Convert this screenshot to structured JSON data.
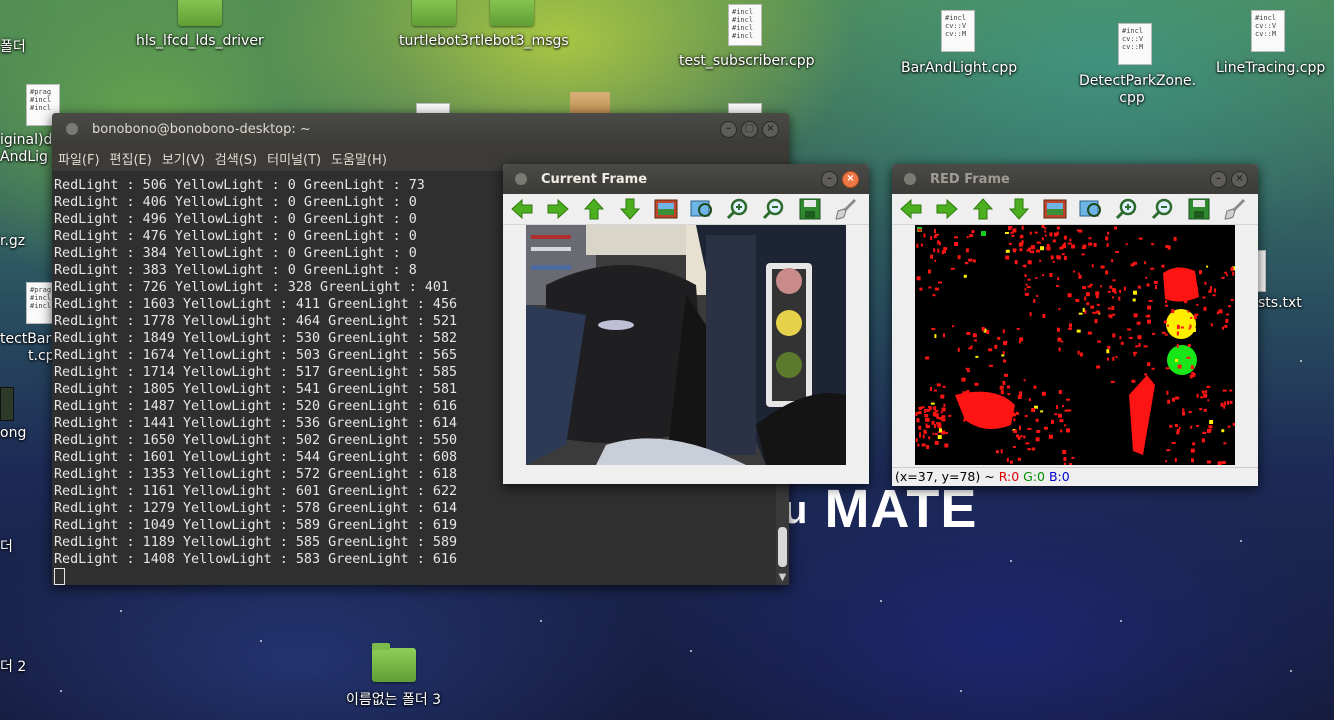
{
  "desktop": {
    "icons": [
      {
        "label": "폴더"
      },
      {
        "label": "hls_lfcd_lds_driver"
      },
      {
        "label": "turtlebot3rtlebot3_msgs"
      },
      {
        "label": "test_subscriber.cpp"
      },
      {
        "label": "BarAndLight.cpp"
      },
      {
        "label": "DetectParkZone.\ncpp"
      },
      {
        "label": "LineTracing.cpp"
      },
      {
        "label": "iginal)d"
      },
      {
        "label": "AndLig"
      },
      {
        "label": "r.gz"
      },
      {
        "label": "tectBar"
      },
      {
        "label": "t.cp"
      },
      {
        "label": "ong"
      },
      {
        "label": "sts.txt"
      },
      {
        "label": "더"
      },
      {
        "label": "더 2"
      },
      {
        "label": "이름없는 폴더 3"
      }
    ],
    "doc_snippet": "#incl\n\ncv::V\ncv::M",
    "doc_snippet2": "#incl\n#incl\n#incl\n#incl",
    "doc_snippet3": "#prag\n\n#incl\n#incl",
    "wallpaper_text": "MATE",
    "wallpaper_text_prefix": "u"
  },
  "terminal": {
    "title": "bonobono@bonobono-desktop: ~",
    "menu": [
      "파일(F)",
      "편집(E)",
      "보기(V)",
      "검색(S)",
      "터미널(T)",
      "도움말(H)"
    ],
    "lines": [
      "RedLight : 506 YellowLight : 0 GreenLight : 73",
      "RedLight : 406 YellowLight : 0 GreenLight : 0",
      "RedLight : 496 YellowLight : 0 GreenLight : 0",
      "RedLight : 476 YellowLight : 0 GreenLight : 0",
      "RedLight : 384 YellowLight : 0 GreenLight : 0",
      "RedLight : 383 YellowLight : 0 GreenLight : 8",
      "RedLight : 726 YellowLight : 328 GreenLight : 401",
      "RedLight : 1603 YellowLight : 411 GreenLight : 456",
      "RedLight : 1778 YellowLight : 464 GreenLight : 521",
      "RedLight : 1849 YellowLight : 530 GreenLight : 582",
      "RedLight : 1674 YellowLight : 503 GreenLight : 565",
      "RedLight : 1714 YellowLight : 517 GreenLight : 585",
      "RedLight : 1805 YellowLight : 541 GreenLight : 581",
      "RedLight : 1487 YellowLight : 520 GreenLight : 616",
      "RedLight : 1441 YellowLight : 536 GreenLight : 614",
      "RedLight : 1650 YellowLight : 502 GreenLight : 550",
      "RedLight : 1601 YellowLight : 544 GreenLight : 608",
      "RedLight : 1353 YellowLight : 572 GreenLight : 618",
      "RedLight : 1161 YellowLight : 601 GreenLight : 622",
      "RedLight : 1279 YellowLight : 578 GreenLight : 614",
      "RedLight : 1049 YellowLight : 589 GreenLight : 619",
      "RedLight : 1189 YellowLight : 585 GreenLight : 589",
      "RedLight : 1408 YellowLight : 583 GreenLight : 616"
    ]
  },
  "current_frame": {
    "title": "Current Frame"
  },
  "red_frame": {
    "title": "RED Frame",
    "status_coords": "(x=37, y=78) ~",
    "status_r": "R:0",
    "status_g": "G:0",
    "status_b": "B:0"
  },
  "toolbar_icons": [
    "arrow-left-icon",
    "arrow-right-icon",
    "arrow-up-icon",
    "arrow-down-icon",
    "image-icon",
    "zoom-fit-icon",
    "zoom-in-icon",
    "zoom-out-icon",
    "save-icon",
    "brush-icon"
  ],
  "colors": {
    "terminal_bg": "#2f2f2f",
    "titlebar": "#3c3b37",
    "close_button": "#f07746",
    "toolbar_arrow": "#4caf1f"
  }
}
